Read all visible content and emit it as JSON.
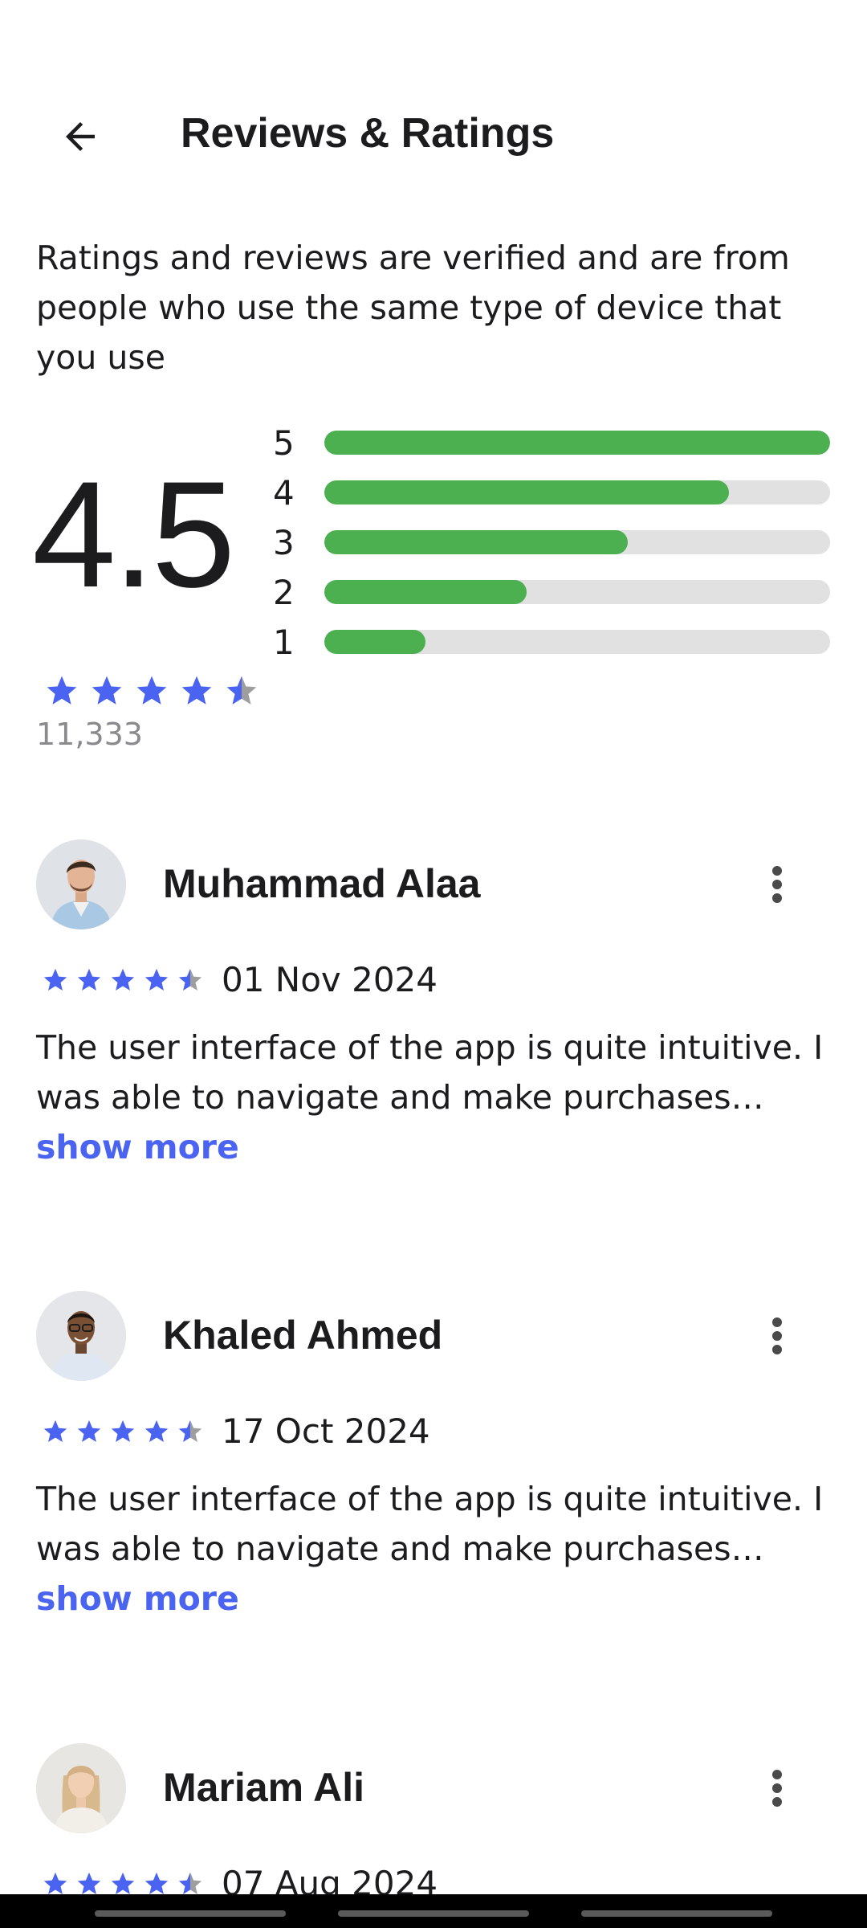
{
  "header": {
    "title": "Reviews & Ratings",
    "back_icon": "arrow-left-icon"
  },
  "intro_text": "Ratings and reviews are verified and are from people who use the same type of device that you use",
  "summary": {
    "average": "4.5",
    "stars": 4.5,
    "count": "11,333",
    "distribution": [
      {
        "label": "5",
        "fraction": 1.0
      },
      {
        "label": "4",
        "fraction": 0.8
      },
      {
        "label": "3",
        "fraction": 0.6
      },
      {
        "label": "2",
        "fraction": 0.4
      },
      {
        "label": "1",
        "fraction": 0.2
      }
    ]
  },
  "colors": {
    "accent": "#4a63f0",
    "bar_fill": "#4caf50",
    "bar_track": "#e1e1e1",
    "star_empty": "#9e9e9e",
    "muted_text": "#8a8a8e"
  },
  "reviews": [
    {
      "name": "Muhammad Alaa",
      "rating": 4.5,
      "date": "01 Nov 2024",
      "text": "The user interface of the app is quite intuitive. I was able to navigate and make purchases…",
      "show_more": "show more"
    },
    {
      "name": "Khaled Ahmed",
      "rating": 4.5,
      "date": "17 Oct 2024",
      "text": "The user interface of the app is quite intuitive. I was able to navigate and make purchases…",
      "show_more": "show more"
    },
    {
      "name": "Mariam Ali",
      "rating": 4.5,
      "date": "07 Aug 2024",
      "text": "",
      "show_more": ""
    }
  ]
}
